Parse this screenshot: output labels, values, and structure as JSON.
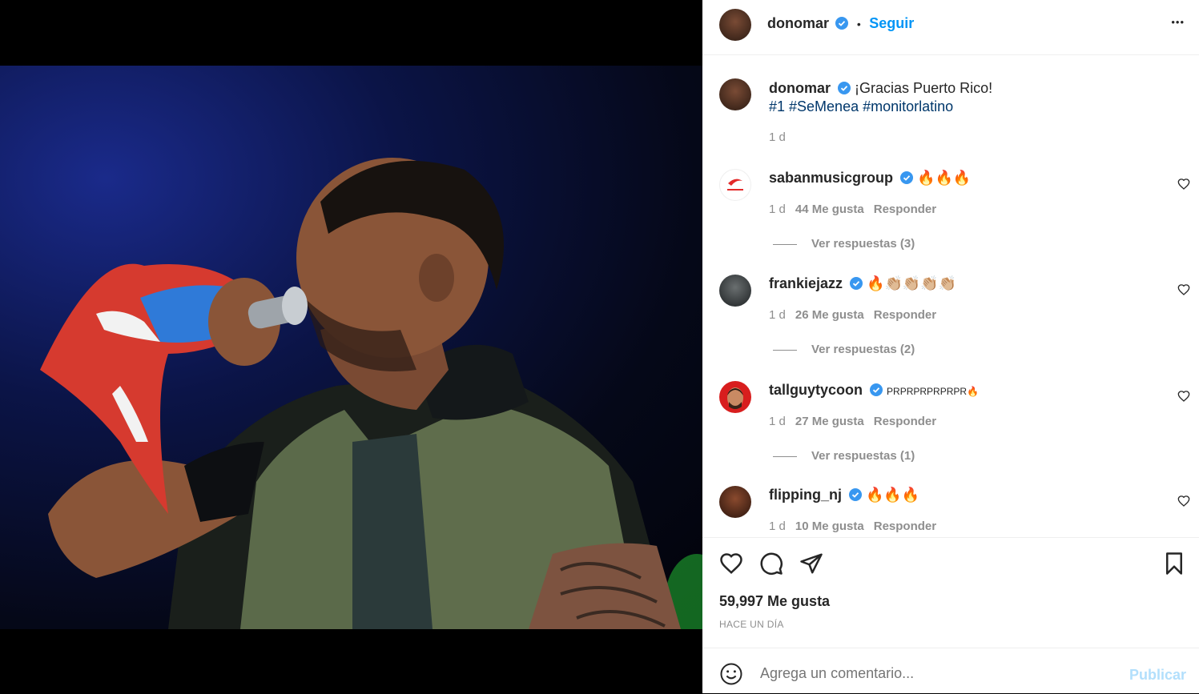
{
  "post": {
    "username": "donomar",
    "follow_label": "Seguir",
    "dot": "•",
    "more_label": "•••",
    "caption_text": "¡Gracias Puerto Rico!",
    "caption_hashtags": "#1 #SeMenea #monitorlatino",
    "caption_time": "1 d",
    "likes": "59,997 Me gusta",
    "posted": "HACE UN DÍA",
    "comment_placeholder": "Agrega un comentario...",
    "publish_label": "Publicar"
  },
  "comments": [
    {
      "user": "sabanmusicgroup",
      "text": "🔥🔥🔥",
      "time": "1 d",
      "likes": "44 Me gusta",
      "reply": "Responder",
      "view_replies": "Ver respuestas (3)"
    },
    {
      "user": "frankiejazz",
      "text": "🔥👏🏼👏🏼👏🏼👏🏼",
      "time": "1 d",
      "likes": "26 Me gusta",
      "reply": "Responder",
      "view_replies": "Ver respuestas (2)"
    },
    {
      "user": "tallguytycoon",
      "text": "PRPRPRPRPRPR🔥",
      "time": "1 d",
      "likes": "27 Me gusta",
      "reply": "Responder",
      "view_replies": "Ver respuestas (1)"
    },
    {
      "user": "flipping_nj",
      "text": "🔥🔥🔥",
      "time": "1 d",
      "likes": "10 Me gusta",
      "reply": "Responder",
      "view_replies": ""
    }
  ],
  "colors": {
    "accent": "#0095f6",
    "verified": "#3897f0",
    "hashtag": "#00376b",
    "muted": "#8e8e8e"
  }
}
